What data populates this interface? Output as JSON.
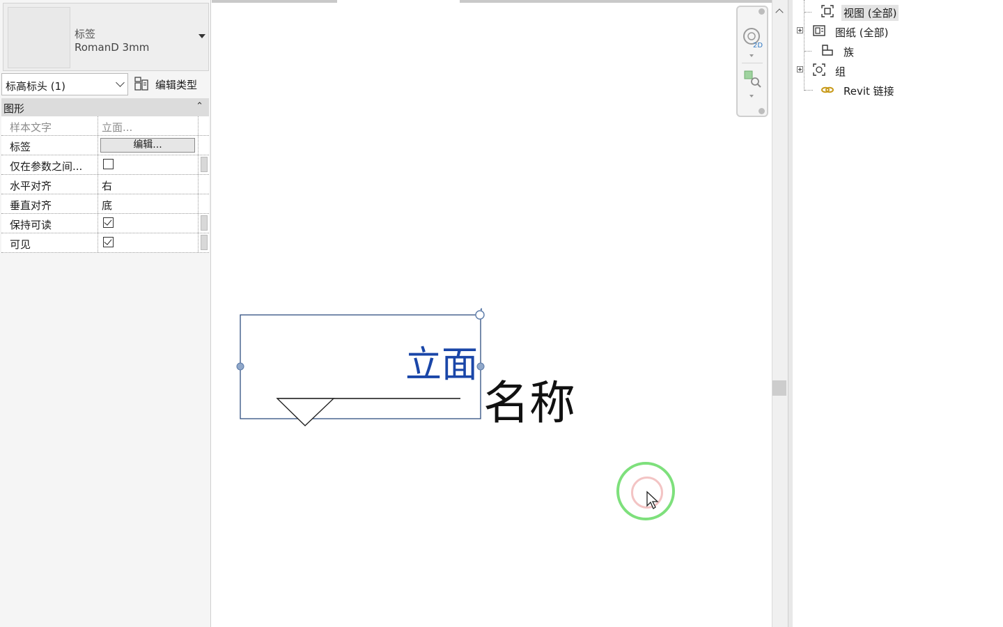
{
  "properties": {
    "type_selector": {
      "family": "标签",
      "type_name": "RomanD 3mm"
    },
    "instance_filter": "标高标头 (1)",
    "edit_type_label": "编辑类型",
    "category": "图形",
    "rows": [
      {
        "name": "样本文字",
        "value": "立面...",
        "kind": "text",
        "disabled": true
      },
      {
        "name": "标签",
        "value": "编辑...",
        "kind": "button"
      },
      {
        "name": "仅在参数之间...",
        "value": "",
        "kind": "checkbox",
        "checked": false
      },
      {
        "name": "水平对齐",
        "value": "右",
        "kind": "text"
      },
      {
        "name": "垂直对齐",
        "value": "底",
        "kind": "text"
      },
      {
        "name": "保持可读",
        "value": "",
        "kind": "checkbox",
        "checked": true
      },
      {
        "name": "可见",
        "value": "",
        "kind": "checkbox",
        "checked": true
      }
    ]
  },
  "canvas": {
    "sample_label": "立面",
    "name_text": "名称",
    "sample_label_color": "#1a46a8",
    "navbar_icons": [
      "steering-wheel-2d-icon",
      "zoom-region-icon"
    ]
  },
  "project_browser": {
    "items": [
      {
        "label": "视图 (全部)",
        "icon": "view-icon",
        "expandable": false,
        "selected": true
      },
      {
        "label": "图纸 (全部)",
        "icon": "sheet-icon",
        "expandable": true,
        "selected": false
      },
      {
        "label": "族",
        "icon": "family-icon",
        "expandable": false,
        "selected": false
      },
      {
        "label": "组",
        "icon": "group-icon",
        "expandable": true,
        "selected": false
      },
      {
        "label": "Revit 链接",
        "icon": "revit-link-icon",
        "expandable": false,
        "selected": false
      }
    ]
  }
}
